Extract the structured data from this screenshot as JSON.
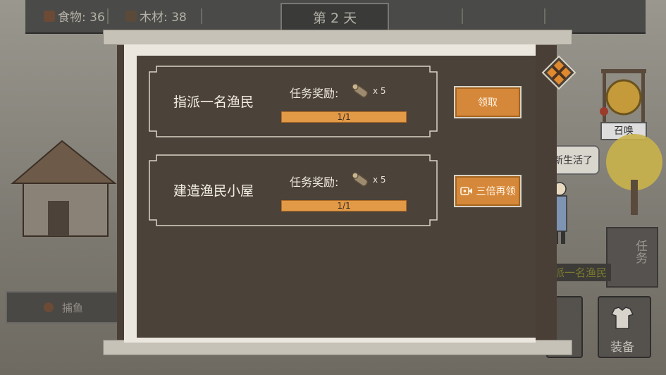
{
  "hud": {
    "food_label": "食物: 36",
    "wood_label": "木材: 38",
    "day_label": "第 2 天"
  },
  "background": {
    "fishing_button": "捕鱼",
    "summon_label": "召唤",
    "speech_bubble": "新生活了",
    "task_side_label": "任务",
    "fisher_hint": "派一名渔民",
    "equipment_label": "装备"
  },
  "tasks": [
    {
      "title": "指派一名渔民",
      "reward_label": "任务奖励:",
      "reward_icon": "wood-log-icon",
      "reward_amount": "x 5",
      "progress_text": "1/1",
      "progress": 1.0,
      "button_label": "领取",
      "button_icon": ""
    },
    {
      "title": "建造渔民小屋",
      "reward_label": "任务奖励:",
      "reward_icon": "wood-log-icon",
      "reward_amount": "x 5",
      "progress_text": "1/1",
      "progress": 1.0,
      "button_label": "三倍再领",
      "button_icon": "video-camera-icon"
    }
  ],
  "colors": {
    "accent_orange": "#d6883a",
    "panel_dark": "#4b4239",
    "close_orange": "#e0892f"
  }
}
